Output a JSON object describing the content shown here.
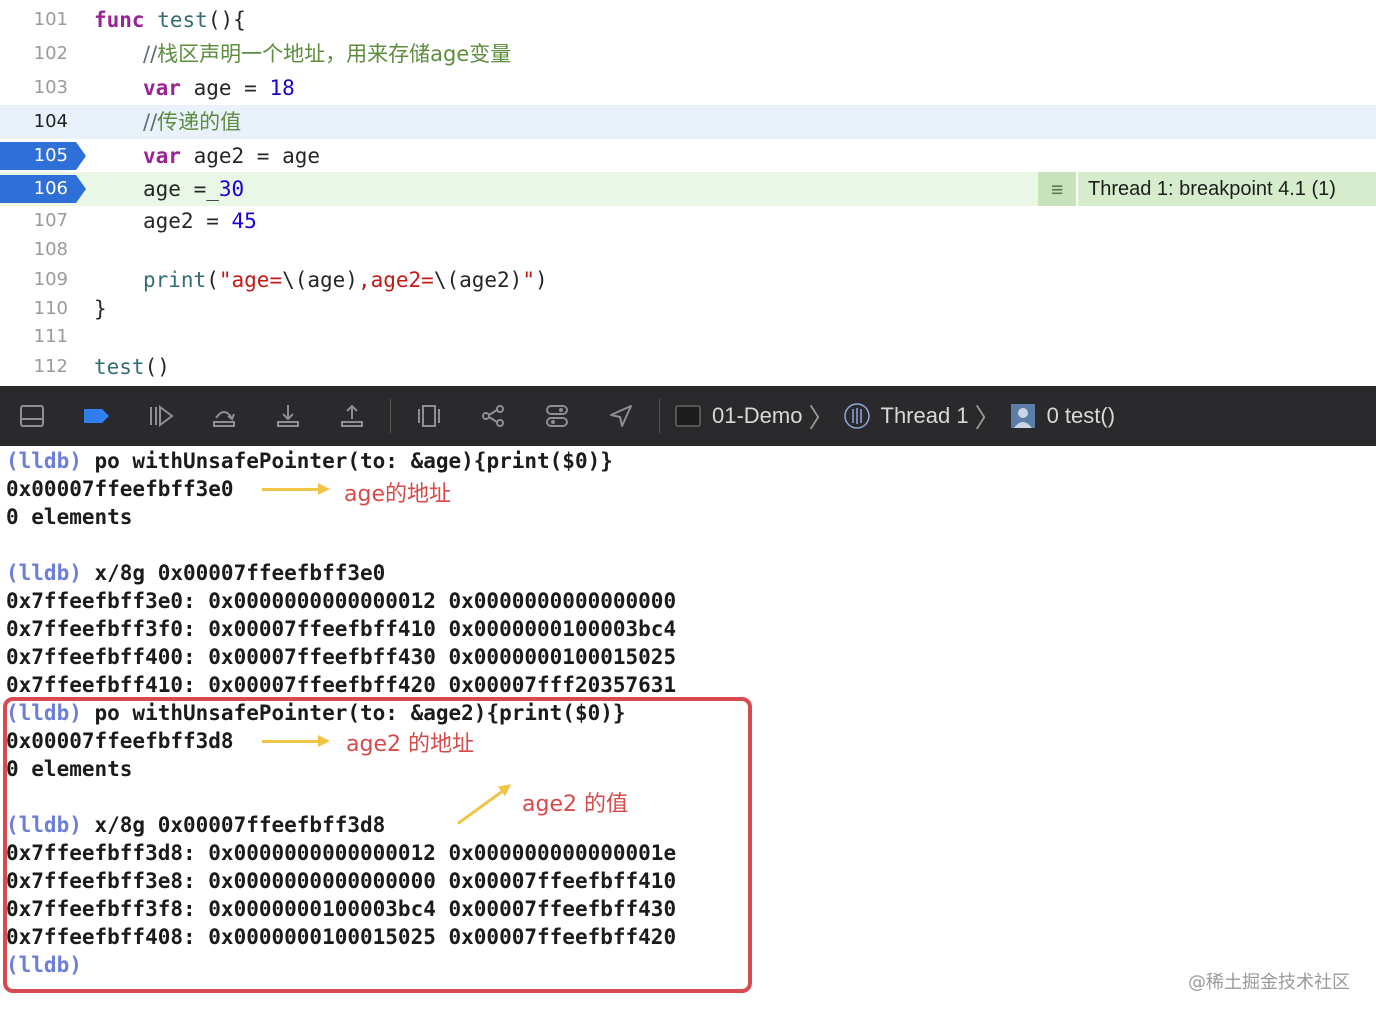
{
  "editor": {
    "lines": [
      {
        "num": "101"
      },
      {
        "num": "102"
      },
      {
        "num": "103"
      },
      {
        "num": "104"
      },
      {
        "num": "105"
      },
      {
        "num": "106"
      },
      {
        "num": "107"
      },
      {
        "num": "108"
      },
      {
        "num": "109"
      },
      {
        "num": "110"
      },
      {
        "num": "111"
      },
      {
        "num": "112"
      }
    ],
    "code": {
      "l101_kw": "func",
      "l101_fn": "test",
      "l101_rest": "(){",
      "l102_comment_prefix": "//",
      "l102_comment": "栈区声明一个地址，用来存储age变量",
      "l103_kw": "var",
      "l103_mid": " age = ",
      "l103_num": "18",
      "l104_comment_prefix": "//",
      "l104_comment": "传递的值",
      "l105_kw": "var",
      "l105_rest": " age2 = age",
      "l106_mid": "age =_",
      "l106_num": "30",
      "l107_mid": "age2 = ",
      "l107_num": "45",
      "l109_fn": "print",
      "l109_p1": "(",
      "l109_s1": "\"age=",
      "l109_i1": "\\(age)",
      "l109_s2": ",age2=",
      "l109_i2": "\\(age2)",
      "l109_s3": "\"",
      "l109_p2": ")",
      "l110": "}",
      "l112_fn": "test",
      "l112_rest": "()"
    },
    "breakpoints": [
      "105",
      "106"
    ],
    "current_line": "104",
    "thread_badge": "Thread 1: breakpoint 4.1 (1)"
  },
  "toolbar": {
    "buttons": [
      "hide-debug-area",
      "breakpoints-toggle",
      "continue",
      "step-over",
      "step-into",
      "step-out",
      "view-hierarchy",
      "memory-graph",
      "environment-overrides",
      "simulate-location"
    ],
    "breadcrumb": {
      "target": "01-Demo",
      "thread": "Thread 1",
      "frame": "0 test()"
    },
    "colors": {
      "background": "#2a2a2c",
      "active_icon": "#2f7ff0"
    }
  },
  "console": {
    "prompt": "(lldb)",
    "lines": {
      "c1_cmd": " po withUnsafePointer(to: &age){print($0)}",
      "c2": "0x00007ffeefbff3e0",
      "c3": "0 elements",
      "c5_cmd": " x/8g 0x00007ffeefbff3e0",
      "c6": "0x7ffeefbff3e0: 0x0000000000000012 0x0000000000000000",
      "c7": "0x7ffeefbff3f0: 0x00007ffeefbff410 0x0000000100003bc4",
      "c8": "0x7ffeefbff400: 0x00007ffeefbff430 0x0000000100015025",
      "c9": "0x7ffeefbff410: 0x00007ffeefbff420 0x00007fff20357631",
      "c10_cmd": " po withUnsafePointer(to: &age2){print($0)}",
      "c11": "0x00007ffeefbff3d8",
      "c12": "0 elements",
      "c14_cmd": " x/8g 0x00007ffeefbff3d8",
      "c15": "0x7ffeefbff3d8: 0x0000000000000012 0x000000000000001e",
      "c16": "0x7ffeefbff3e8: 0x0000000000000000 0x00007ffeefbff410",
      "c17": "0x7ffeefbff3f8: 0x0000000100003bc4 0x00007ffeefbff430",
      "c18": "0x7ffeefbff408: 0x0000000100015025 0x00007ffeefbff420"
    },
    "annotations": {
      "age_addr": "age的地址",
      "age2_addr": "age2 的地址",
      "age2_val": "age2 的值"
    },
    "annotation_color": "#d64a4a",
    "arrow_color": "#f0c446",
    "highlight_box_color": "#d84a4f"
  },
  "watermark": "@稀土掘金技术社区"
}
